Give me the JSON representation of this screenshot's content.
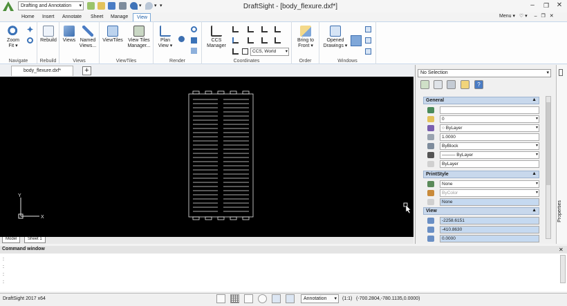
{
  "titlebar": {
    "workspace": "Drafting and Annotation",
    "title": "DraftSight - [body_flexure.dxf*]",
    "menu": "Menu ▾"
  },
  "ribbon": {
    "tabs": [
      "Home",
      "Insert",
      "Annotate",
      "Sheet",
      "Manage",
      "View"
    ],
    "active_tab": "View",
    "groups": {
      "navigate": {
        "label": "Navigate",
        "zoom_fit": "Zoom Fit ▾"
      },
      "rebuild": {
        "label": "Rebuild",
        "rebuild": "Rebuild"
      },
      "views": {
        "label": "Views",
        "views": "Views",
        "named_views": "Named Views..."
      },
      "viewtiles": {
        "label": "ViewTiles",
        "viewtiles": "ViewTiles",
        "viewtiles_manager": "View Tiles Manager..."
      },
      "render": {
        "label": "Render",
        "plan_view": "Plan View ▾"
      },
      "coordinates": {
        "label": "Coordinates",
        "ccs_manager": "CCS Manager",
        "ccs_world": "CCS, World"
      },
      "order": {
        "label": "Order",
        "bring_to_front": "Bring to Front ▾"
      },
      "windows": {
        "label": "Windows",
        "opened_drawings": "Opened Drawings ▾"
      }
    }
  },
  "doc": {
    "tab": "body_flexure.dxf*",
    "layout_tabs": [
      "Model",
      "Sheet 1"
    ]
  },
  "properties": {
    "selection": "No Selection",
    "vertical_label": "Properties",
    "general": {
      "header": "General",
      "rows": [
        {
          "value": "",
          "dropdown": false,
          "blue": false
        },
        {
          "value": "0",
          "dropdown": true,
          "blue": false
        },
        {
          "value": "○ ByLayer",
          "dropdown": true,
          "blue": false
        },
        {
          "value": "1.0000",
          "dropdown": false,
          "blue": false
        },
        {
          "value": "ByBlock",
          "dropdown": true,
          "blue": false
        },
        {
          "value": "——— ByLayer",
          "dropdown": true,
          "blue": false
        },
        {
          "value": "ByLayer",
          "dropdown": false,
          "blue": false
        }
      ]
    },
    "printstyle": {
      "header": "PrintStyle",
      "rows": [
        {
          "value": "None",
          "dropdown": true,
          "blue": false
        },
        {
          "value": "ByColor",
          "dropdown": true,
          "blue": false
        },
        {
          "value": "None",
          "dropdown": false,
          "blue": true
        }
      ]
    },
    "view": {
      "header": "View",
      "rows": [
        {
          "value": "-2258.6151",
          "dropdown": false,
          "blue": true
        },
        {
          "value": "-410.8630",
          "dropdown": false,
          "blue": true
        },
        {
          "value": "0.0000",
          "dropdown": false,
          "blue": true
        }
      ]
    }
  },
  "command": {
    "header": "Command window",
    "lines": [
      ":",
      ":",
      ":",
      ":"
    ]
  },
  "status": {
    "app": "DraftSight 2017 x64",
    "annotation": "Annotation",
    "scale": "(1:1)",
    "coords": "(-700.2804,-780.1135,0.0000)"
  },
  "colors": {
    "accent": "#1e5fa8",
    "canvas": "#000000",
    "section": "#c8d8ec",
    "field_blue": "#c5d9f0"
  },
  "icons": {
    "axis": "ucs-axis-icon",
    "cursor": "crosshair-cursor-icon"
  }
}
